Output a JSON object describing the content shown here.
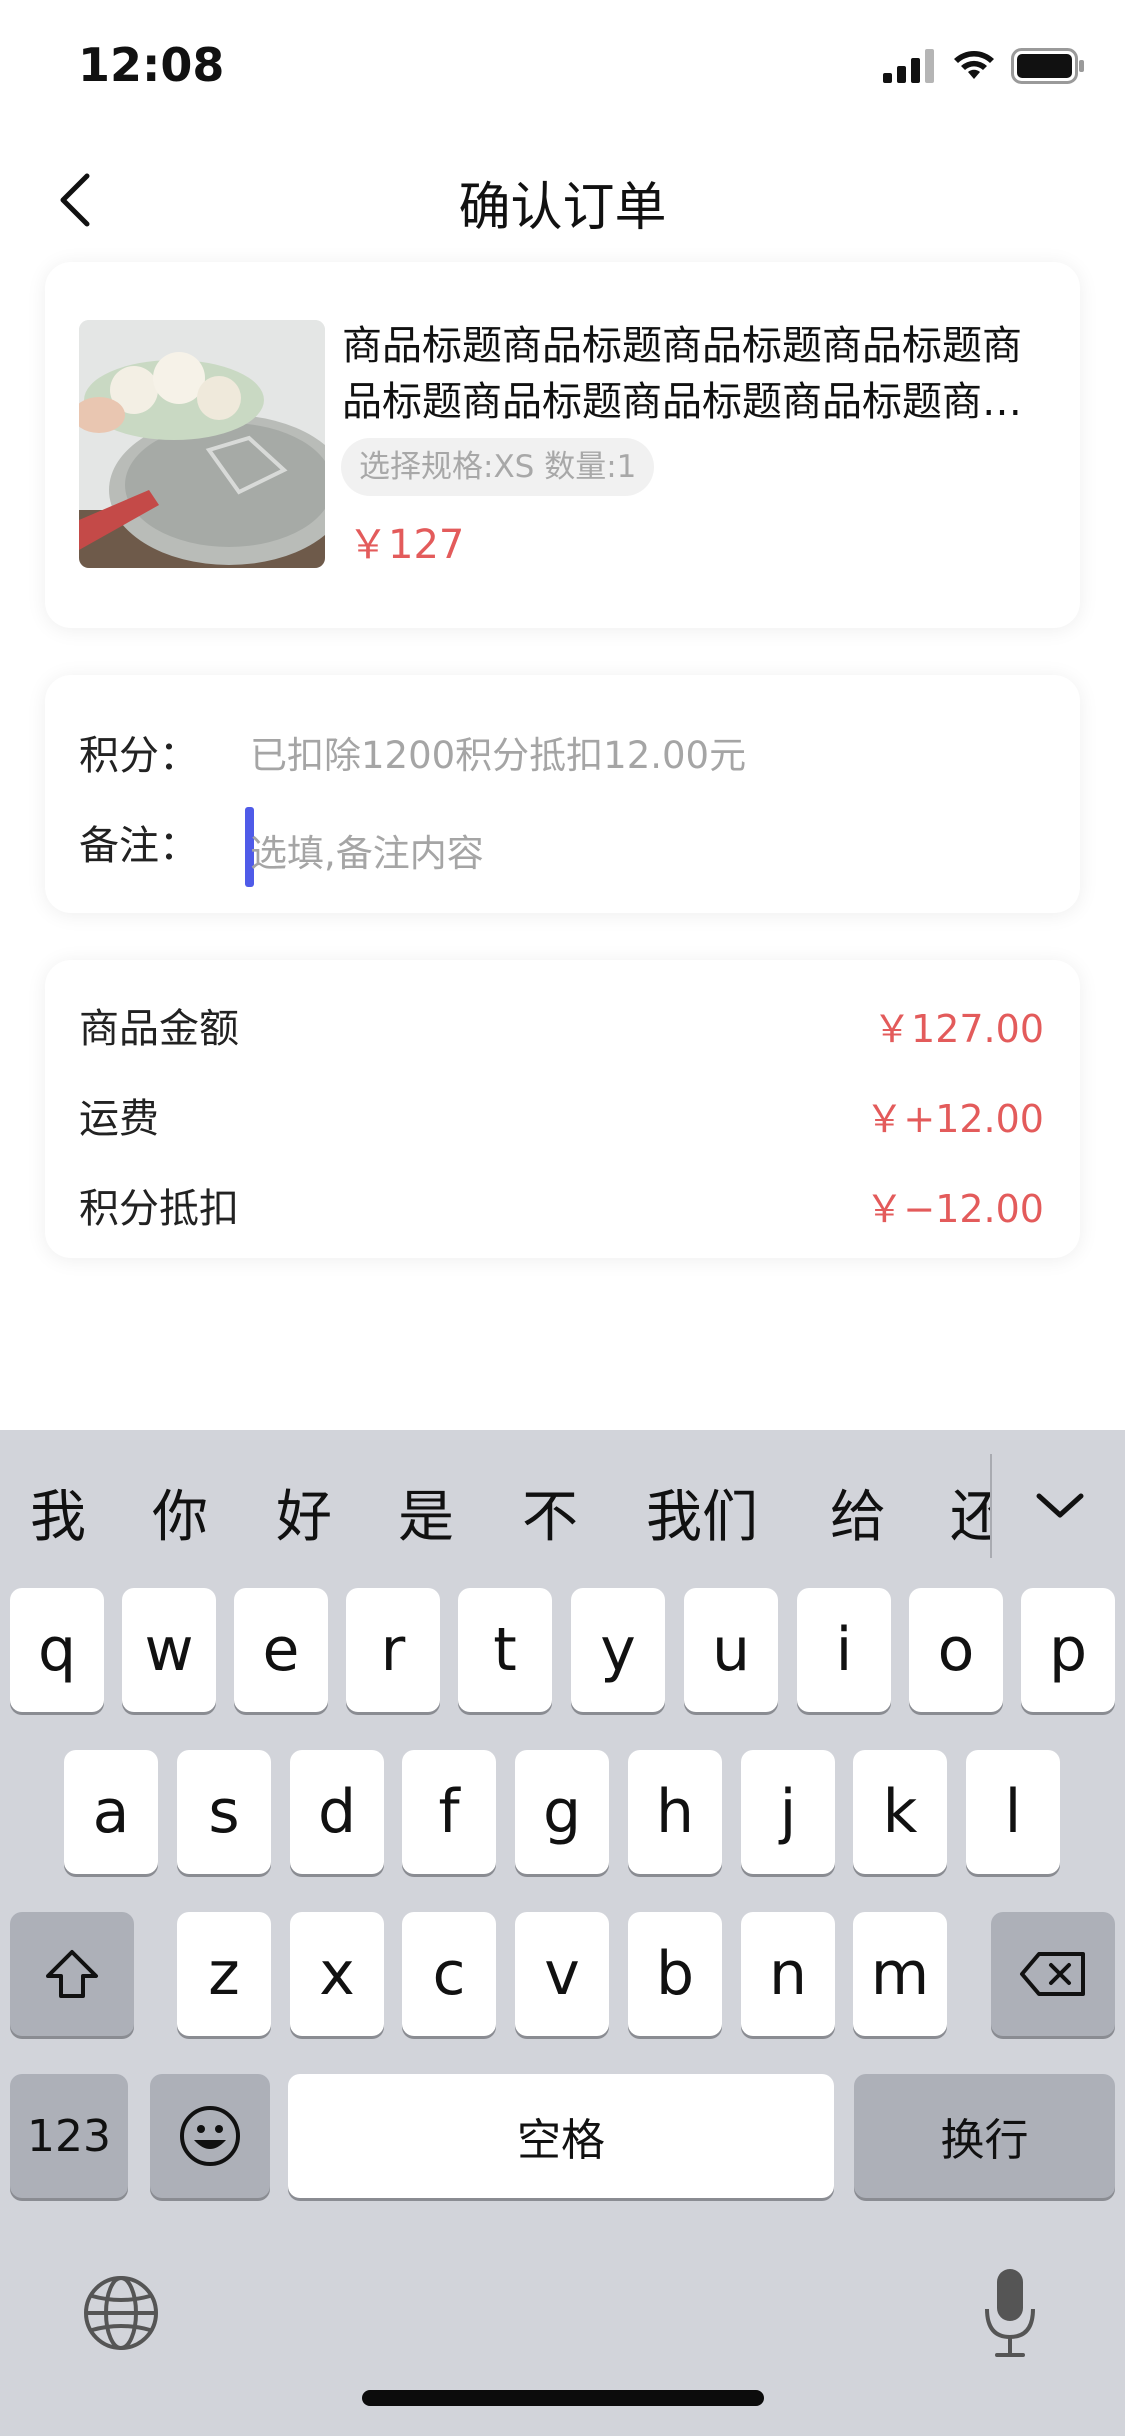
{
  "status_bar": {
    "time": "12:08"
  },
  "nav": {
    "title": "确认订单"
  },
  "product": {
    "title": "商品标题商品标题商品标题商品标题商品标题商品标题商品标题商品标题商品标题",
    "spec": "选择规格:XS 数量:1",
    "price": "￥127"
  },
  "order_info": {
    "points_label": "积分：",
    "points_value": "已扣除1200积分抵扣12.00元",
    "remark_label": "备注：",
    "remark_placeholder": "选填,备注内容",
    "remark_value": ""
  },
  "summary": {
    "rows": [
      {
        "label": "商品金额",
        "value": "￥127.00"
      },
      {
        "label": "运费",
        "value": "￥+12.00"
      },
      {
        "label": "积分抵扣",
        "value": "￥−12.00"
      }
    ]
  },
  "keyboard": {
    "candidates": [
      "我",
      "你",
      "好",
      "是",
      "不",
      "我们",
      "给",
      "还"
    ],
    "row1": [
      "q",
      "w",
      "e",
      "r",
      "t",
      "y",
      "u",
      "i",
      "o",
      "p"
    ],
    "row2": [
      "a",
      "s",
      "d",
      "f",
      "g",
      "h",
      "j",
      "k",
      "l"
    ],
    "row3": [
      "z",
      "x",
      "c",
      "v",
      "b",
      "n",
      "m"
    ],
    "num_key": "123",
    "space_key": "空格",
    "return_key": "换行",
    "icons": {
      "shift": "shift-icon",
      "delete": "delete-icon",
      "emoji": "emoji-icon",
      "globe": "globe-icon",
      "mic": "microphone-icon",
      "collapse": "chevron-down-icon"
    }
  },
  "colors": {
    "price_red": "#e35b5b",
    "cursor_blue": "#4f5be8",
    "keyboard_bg": "#d2d4da",
    "function_key": "#adb0b8"
  }
}
